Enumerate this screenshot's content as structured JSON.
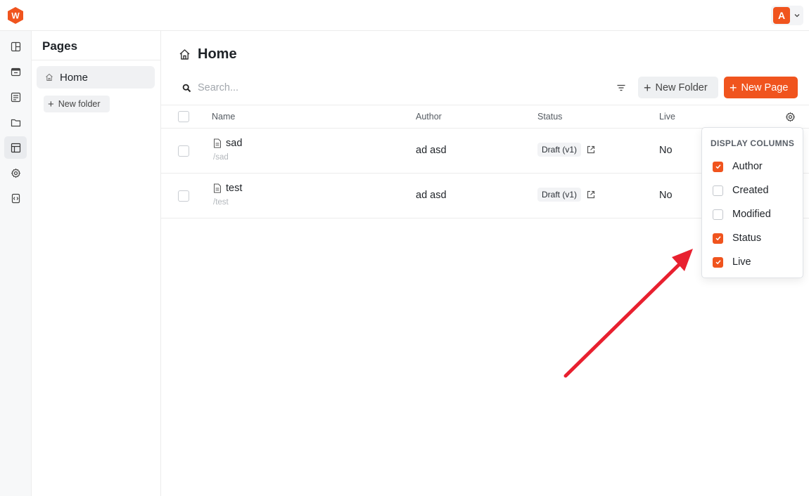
{
  "app": {
    "logo_letter": "W",
    "brand_color": "#f0541e",
    "user_initial": "A"
  },
  "rail": {
    "items": [
      {
        "icon": "layout-icon"
      },
      {
        "icon": "browser-icon"
      },
      {
        "icon": "document-icon"
      },
      {
        "icon": "folder-icon"
      },
      {
        "icon": "table-icon",
        "active": true
      },
      {
        "icon": "gear-icon"
      },
      {
        "icon": "code-file-icon"
      }
    ]
  },
  "sidebar": {
    "title": "Pages",
    "tree": [
      {
        "label": "Home",
        "icon": "home-icon",
        "selected": true
      }
    ],
    "new_folder_label": "New folder"
  },
  "main": {
    "title": "Home",
    "search_placeholder": "Search...",
    "new_folder_button": "New Folder",
    "new_page_button": "New Page",
    "columns": [
      "Name",
      "Author",
      "Status",
      "Live"
    ],
    "rows": [
      {
        "name": "sad",
        "slug": "/sad",
        "author": "ad asd",
        "status": "Draft (v1)",
        "live": "No"
      },
      {
        "name": "test",
        "slug": "/test",
        "author": "ad asd",
        "status": "Draft (v1)",
        "live": "No"
      }
    ]
  },
  "display_columns": {
    "title": "DISPLAY COLUMNS",
    "options": [
      {
        "label": "Author",
        "checked": true
      },
      {
        "label": "Created",
        "checked": false
      },
      {
        "label": "Modified",
        "checked": false
      },
      {
        "label": "Status",
        "checked": true
      },
      {
        "label": "Live",
        "checked": true
      }
    ]
  },
  "annotation": {
    "arrow_color": "#e8202f"
  }
}
